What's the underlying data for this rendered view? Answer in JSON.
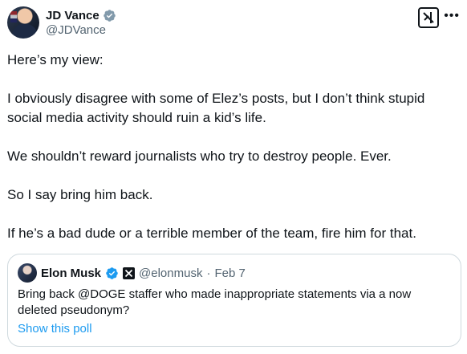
{
  "author": {
    "name": "JD Vance",
    "handle": "@JDVance"
  },
  "post": {
    "paragraphs": [
      "Here’s my view:",
      "I obviously disagree with some of Elez’s posts, but I don’t think stupid social media activity should ruin a kid’s life.",
      "We shouldn’t reward journalists who try to destroy people. Ever.",
      "So I say bring him back.",
      "If he’s a bad dude or a terrible member of the team, fire him for that."
    ]
  },
  "quoted": {
    "name": "Elon Musk",
    "handle": "@elonmusk",
    "separator": "·",
    "date": "Feb 7",
    "text": "Bring back @DOGE staffer who made inappropriate statements via a now deleted pseudonym?",
    "link_label": "Show this poll"
  },
  "colors": {
    "verified_gray": "#829aab",
    "verified_blue": "#1d9bf0",
    "link": "#1d9bf0",
    "secondary_text": "#536471"
  },
  "icons": {
    "more": "more-horizontal-icon",
    "grok": "grok-icon"
  }
}
